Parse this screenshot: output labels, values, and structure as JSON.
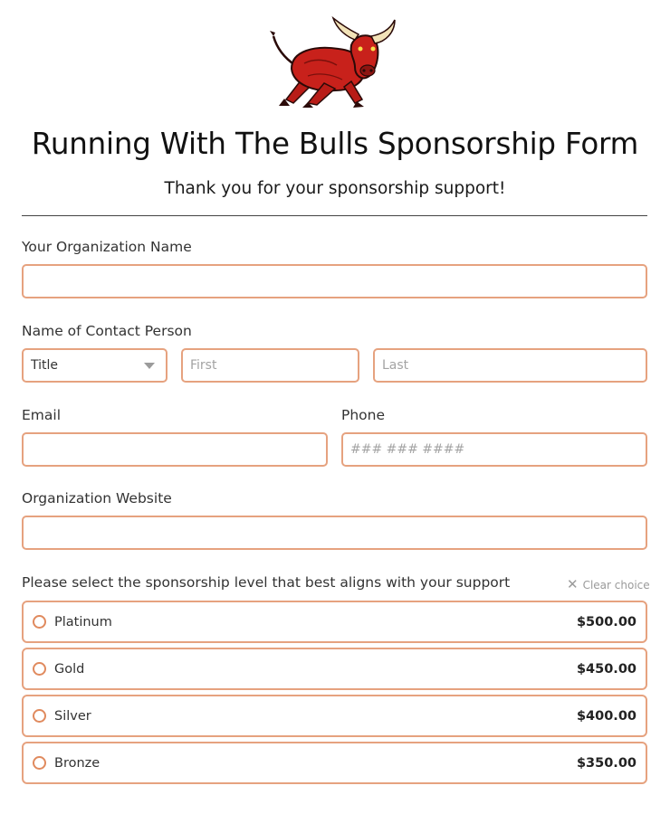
{
  "form": {
    "title": "Running With The Bulls Sponsorship Form",
    "subtitle": "Thank you for your sponsorship support!"
  },
  "fields": {
    "organization_name": {
      "label": "Your Organization Name",
      "value": ""
    },
    "contact_person": {
      "label": "Name of Contact Person",
      "title_select": {
        "value": "Title"
      },
      "first_placeholder": "First",
      "last_placeholder": "Last"
    },
    "email": {
      "label": "Email",
      "value": ""
    },
    "phone": {
      "label": "Phone",
      "placeholder": "### ### ####"
    },
    "website": {
      "label": "Organization Website",
      "value": ""
    }
  },
  "sponsorship": {
    "question": "Please select the sponsorship level that best aligns with your support",
    "clear_label": "Clear choice",
    "options": [
      {
        "label": "Platinum",
        "price": "$500.00"
      },
      {
        "label": "Gold",
        "price": "$450.00"
      },
      {
        "label": "Silver",
        "price": "$400.00"
      },
      {
        "label": "Bronze",
        "price": "$350.00"
      }
    ]
  },
  "colors": {
    "field_border": "#e6a27f",
    "radio_border": "#e08a5e",
    "logo_bull": "#c8211b"
  },
  "icons": {
    "logo": "charging-bull-logo",
    "select_caret": "caret-down-icon",
    "clear": "close-icon"
  }
}
